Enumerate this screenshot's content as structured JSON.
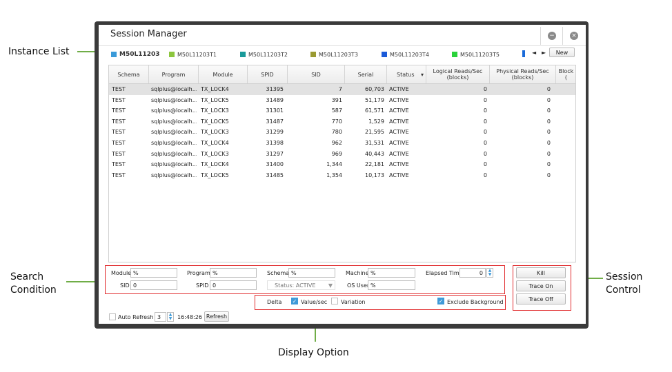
{
  "annotations": {
    "instance_list": "Instance List",
    "search_condition_1": "Search",
    "search_condition_2": "Condition",
    "session_control_1": "Session",
    "session_control_2": "Control",
    "display_option": "Display Option"
  },
  "window": {
    "title": "Session Manager",
    "minimize_icon": "minus-circle-icon",
    "close_icon": "close-circle-icon"
  },
  "instances": [
    {
      "label": "M50L11203",
      "color": "#3a9ad9"
    },
    {
      "label": "M50L11203T1",
      "color": "#8cc63e"
    },
    {
      "label": "M50L11203T2",
      "color": "#1a9a9a"
    },
    {
      "label": "M50L11203T3",
      "color": "#9a9a32"
    },
    {
      "label": "M50L11203T4",
      "color": "#1a5ad9"
    },
    {
      "label": "M50L11203T5",
      "color": "#2ad23a"
    }
  ],
  "nav": {
    "prev": "◄",
    "next": "►",
    "new_label": "New"
  },
  "table": {
    "columns": [
      "Schema",
      "Program",
      "Module",
      "SPID",
      "SID",
      "Serial",
      "Status",
      "Logical Reads/Sec\n(blocks)",
      "Physical Reads/Sec\n(blocks)",
      "Block\n("
    ],
    "rows": [
      [
        "TEST",
        "sqlplus@localh...",
        "TX_LOCK4",
        "31395",
        "7",
        "60,703",
        "ACTIVE",
        "0",
        "0"
      ],
      [
        "TEST",
        "sqlplus@localh...",
        "TX_LOCK5",
        "31489",
        "391",
        "51,179",
        "ACTIVE",
        "0",
        "0"
      ],
      [
        "TEST",
        "sqlplus@localh...",
        "TX_LOCK3",
        "31301",
        "587",
        "61,571",
        "ACTIVE",
        "0",
        "0"
      ],
      [
        "TEST",
        "sqlplus@localh...",
        "TX_LOCK5",
        "31487",
        "770",
        "1,529",
        "ACTIVE",
        "0",
        "0"
      ],
      [
        "TEST",
        "sqlplus@localh...",
        "TX_LOCK3",
        "31299",
        "780",
        "21,595",
        "ACTIVE",
        "0",
        "0"
      ],
      [
        "TEST",
        "sqlplus@localh...",
        "TX_LOCK4",
        "31398",
        "962",
        "31,531",
        "ACTIVE",
        "0",
        "0"
      ],
      [
        "TEST",
        "sqlplus@localh...",
        "TX_LOCK3",
        "31297",
        "969",
        "40,443",
        "ACTIVE",
        "0",
        "0"
      ],
      [
        "TEST",
        "sqlplus@localh...",
        "TX_LOCK4",
        "31400",
        "1,344",
        "22,181",
        "ACTIVE",
        "0",
        "0"
      ],
      [
        "TEST",
        "sqlplus@localh...",
        "TX_LOCK5",
        "31485",
        "1,354",
        "10,173",
        "ACTIVE",
        "0",
        "0"
      ]
    ]
  },
  "search": {
    "module_label": "Module",
    "module_value": "%",
    "program_label": "Program",
    "program_value": "%",
    "schema_label": "Schema",
    "schema_value": "%",
    "machine_label": "Machine",
    "machine_value": "%",
    "elapsed_label": "Elapsed Time",
    "elapsed_value": "0",
    "sid_label": "SID",
    "sid_value": "0",
    "spid_label": "SPID",
    "spid_value": "0",
    "status_value": "Status: ACTIVE",
    "osuser_label": "OS User",
    "osuser_value": "%"
  },
  "display": {
    "delta_label": "Delta",
    "value_sec_label": "Value/sec",
    "value_sec_checked": true,
    "variation_label": "Variation",
    "variation_checked": false,
    "exclude_bg_label": "Exclude Background",
    "exclude_bg_checked": true
  },
  "control": {
    "kill": "Kill",
    "trace_on": "Trace On",
    "trace_off": "Trace Off"
  },
  "footer": {
    "auto_refresh_label": "Auto Refresh",
    "auto_refresh_checked": false,
    "interval": "3",
    "time": "16:48:26",
    "refresh_label": "Refresh"
  },
  "colors": {
    "annotation_arrow": "#70ad47",
    "highlight_box": "#e0282a",
    "checkbox_on": "#3f9ad8"
  }
}
